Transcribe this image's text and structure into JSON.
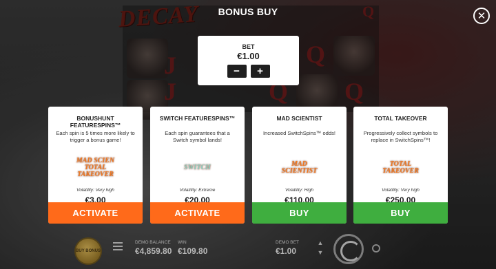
{
  "modal": {
    "title": "BONUS BUY",
    "close_icon": "close-icon"
  },
  "bet": {
    "label": "BET",
    "value": "€1.00",
    "minus_label": "−",
    "plus_label": "+"
  },
  "cards": [
    {
      "title": "BONUSHUNT FEATURESPINS™",
      "description": "Each spin is 5 times more likely to trigger a bonus game!",
      "art_label": "MAD SCIEN TOTAL TAKEOVER",
      "volatility": "Volatility: Very high",
      "price": "€3.00",
      "button": "ACTIVATE",
      "button_color": "#ff6a1a"
    },
    {
      "title": "SWITCH FEATURESPINS™",
      "description": "Each spin guarantees that a Switch symbol lands!",
      "art_label": "SWITCH",
      "volatility": "Volatility: Extreme",
      "price": "€20.00",
      "button": "ACTIVATE",
      "button_color": "#ff6a1a"
    },
    {
      "title": "MAD SCIENTIST",
      "description": "Increased SwitchSpins™ odds!",
      "art_label": "MAD SCIENTIST",
      "volatility": "Volatility: High",
      "price": "€110.00",
      "button": "BUY",
      "button_color": "#3fae3f"
    },
    {
      "title": "TOTAL TAKEOVER",
      "description": "Progressively collect symbols to replace in SwitchSpins™!",
      "art_label": "TOTAL TAKEOVER",
      "volatility": "Volatility: Very high",
      "price": "€250.00",
      "button": "BUY",
      "button_color": "#3fae3f"
    }
  ],
  "game": {
    "logo": "DECAY"
  },
  "bottom_bar": {
    "buy_bonus_label": "BUY BONUS",
    "demo_balance_label": "DEMO BALANCE",
    "demo_balance_value": "€4,859.80",
    "win_label": "WIN",
    "win_value": "€109.80",
    "demo_bet_label": "DEMO BET",
    "demo_bet_value": "€1.00"
  }
}
